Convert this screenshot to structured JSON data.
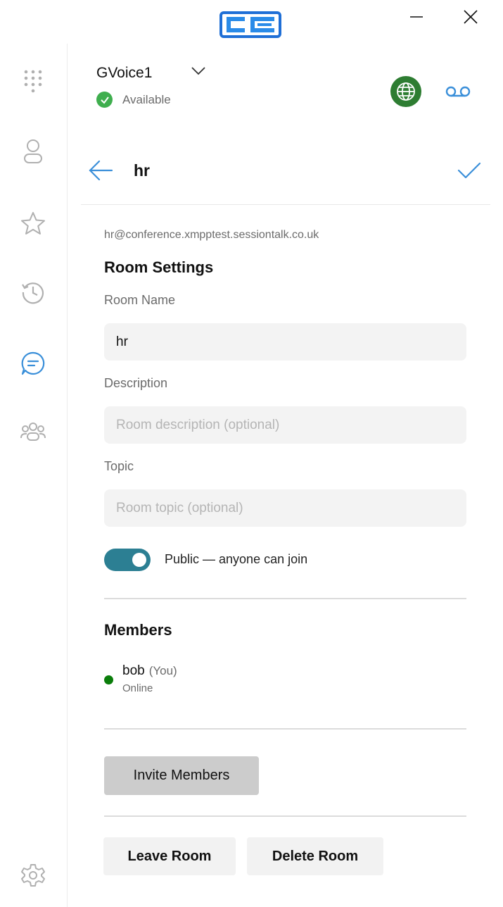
{
  "window": {
    "logo_icon": "cc-logo",
    "minimize_icon": "minimize-icon",
    "close_icon": "close-icon"
  },
  "sidebar": {
    "items": [
      {
        "name": "dialpad",
        "icon": "dialpad-icon",
        "active": false
      },
      {
        "name": "contacts",
        "icon": "person-icon",
        "active": false
      },
      {
        "name": "favorites",
        "icon": "star-icon",
        "active": false
      },
      {
        "name": "history",
        "icon": "history-icon",
        "active": false
      },
      {
        "name": "chat",
        "icon": "chat-icon",
        "active": true
      },
      {
        "name": "groups",
        "icon": "group-icon",
        "active": false
      },
      {
        "name": "settings",
        "icon": "gear-icon",
        "active": false
      }
    ]
  },
  "account": {
    "name": "GVoice1",
    "status": "Available"
  },
  "room": {
    "title": "hr",
    "jid": "hr@conference.xmpptest.sessiontalk.co.uk",
    "settings_title": "Room Settings",
    "name_label": "Room Name",
    "name_value": "hr",
    "description_label": "Description",
    "description_placeholder": "Room description (optional)",
    "topic_label": "Topic",
    "topic_placeholder": "Room topic (optional)",
    "public_label": "Public — anyone can join",
    "public_enabled": true
  },
  "members": {
    "title": "Members",
    "list": [
      {
        "name": "bob",
        "tag": "(You)",
        "status": "Online"
      }
    ]
  },
  "actions": {
    "invite": "Invite Members",
    "leave": "Leave Room",
    "delete": "Delete Room"
  },
  "colors": {
    "accent": "#3a8fd9",
    "toggle": "#2c7f93",
    "available": "#3fae4e",
    "online": "#0a7d0a",
    "globe_bg": "#2e7d32"
  }
}
